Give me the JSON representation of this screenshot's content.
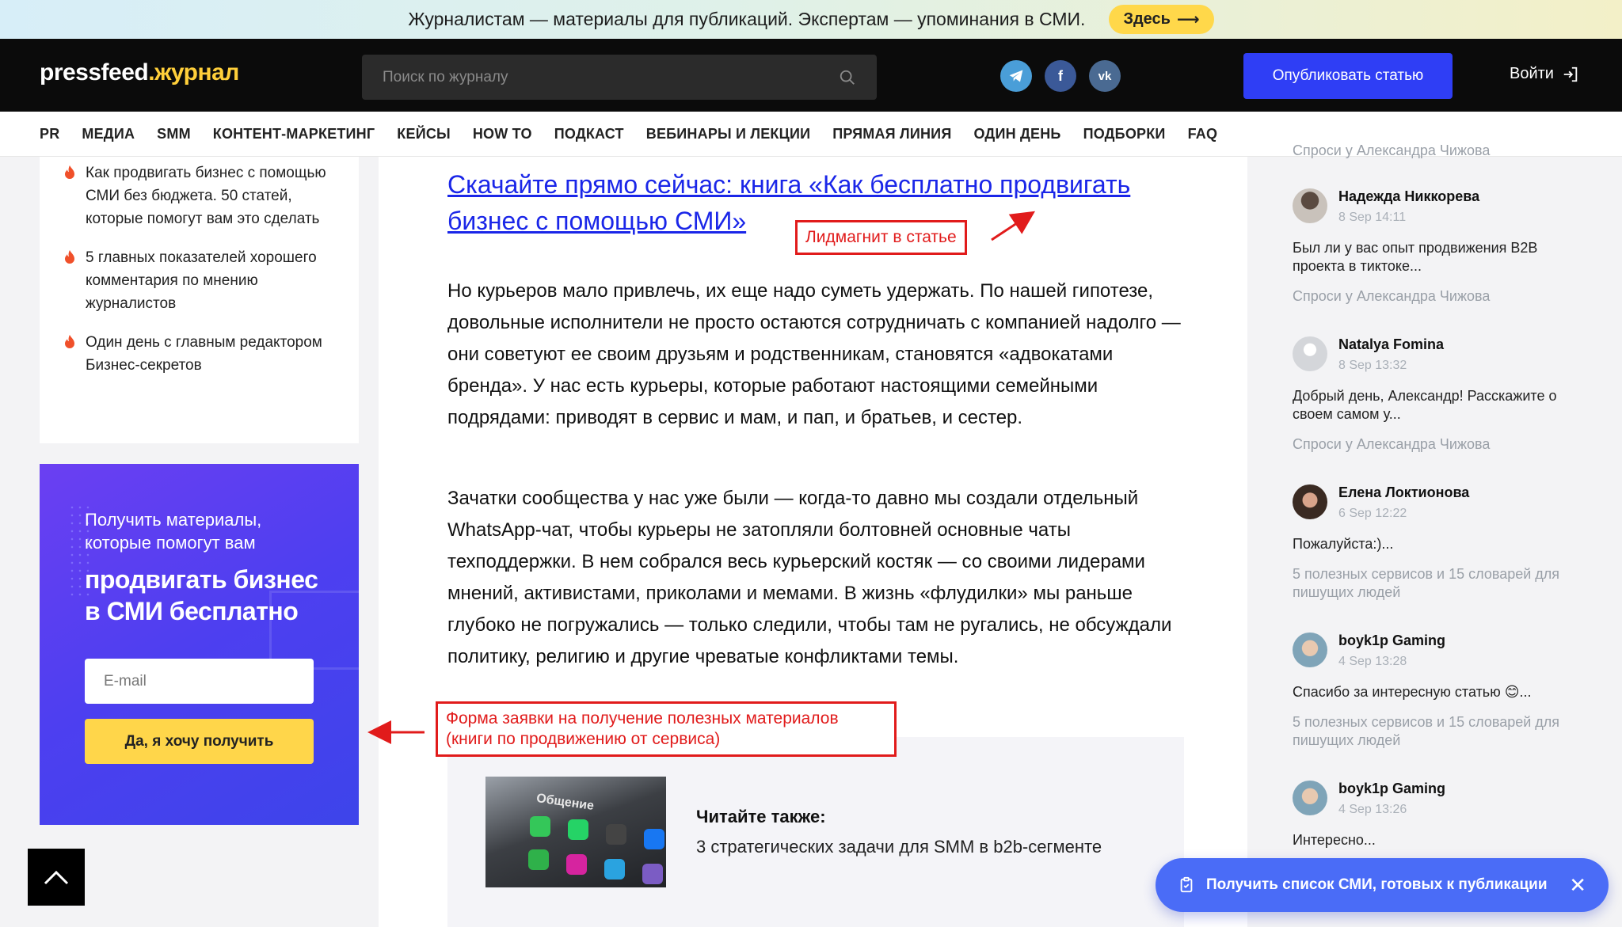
{
  "promo": {
    "text": "Журналистам — материалы для публикаций. Экспертам — упоминания в СМИ.",
    "button": "Здесь"
  },
  "header": {
    "logo_main": "pressfeed",
    "logo_accent": ".журнал",
    "search_placeholder": "Поиск по журналу",
    "publish_button": "Опубликовать статью",
    "login": "Войти"
  },
  "nav": [
    "PR",
    "МЕДИА",
    "SMM",
    "КОНТЕНТ-МАРКЕТИНГ",
    "КЕЙСЫ",
    "HOW TO",
    "ПОДКАСТ",
    "ВЕБИНАРЫ И ЛЕКЦИИ",
    "ПРЯМАЯ ЛИНИЯ",
    "ОДИН ДЕНЬ",
    "ПОДБОРКИ",
    "FAQ"
  ],
  "left": {
    "items": [
      "Как продвигать бизнес с помощью СМИ без бюджета. 50 статей, которые помогут вам это сделать",
      "5 главных показателей хорошего комментария по мнению журналистов",
      "Один день с главным редактором Бизнес-секретов"
    ],
    "lead": {
      "subtitle": "Получить материалы, которые помогут вам",
      "title": "продвигать бизнес в СМИ бесплатно",
      "email_placeholder": "E-mail",
      "button": "Да, я хочу получить"
    }
  },
  "article": {
    "lead_link": "Скачайте прямо сейчас: книга «Как бесплатно продвигать бизнес с помощью СМИ»",
    "paragraph1": "Но курьеров мало привлечь, их еще надо суметь удержать. По нашей гипотезе, довольные исполнители не просто остаются сотрудничать с компанией надолго — они советуют ее своим друзьям и родственникам, становятся «адвокатами бренда». У нас есть курьеры, которые работают настоящими семейными подрядами: приводят в сервис и  мам, и пап, и братьев, и сестер.",
    "paragraph2": "Зачатки сообщества у нас уже были — когда-то давно мы создали отдельный WhatsApp-чат, чтобы курьеры не затопляли болтовней основные чаты техподдержки. В нем собрался весь курьерский костяк — со своими лидерами мнений, активистами, приколами и мемами. В жизнь «флудилки» мы раньше глубоко не погружались — только следили, чтобы там не ругались, не обсуждали политику, религию и другие чреватые конфликтами темы.",
    "related_image_text": "Общение",
    "related_label": "Читайте также:",
    "related_title": "3 стратегических задачи для SMM в b2b-сегменте"
  },
  "annotations": {
    "leadmagnet": "Лидмагнит в статье",
    "form": "Форма заявки на получение полезных материалов (книги по продвижению от сервиса)"
  },
  "right": {
    "top_partial": "Спроси у Александра Чижова",
    "comments": [
      {
        "name": "Надежда Никкорева",
        "date": "8 Sep 14:11",
        "text": "Был ли у вас опыт продвижения B2B проекта в тиктоке...",
        "source": "Спроси у Александра Чижова"
      },
      {
        "name": "Natalya Fomina",
        "date": "8 Sep 13:32",
        "text": "Добрый день, Александр! Расскажите о своем самом у...",
        "source": "Спроси у Александра Чижова"
      },
      {
        "name": "Елена Локтионова",
        "date": "6 Sep 12:22",
        "text": "Пожалуйста:)...",
        "source": "5 полезных сервисов и 15 словарей для пишущих людей"
      },
      {
        "name": "boyk1p Gaming",
        "date": "4 Sep 13:28",
        "text": "Спасибо за интересную статью 😊...",
        "source": "5 полезных сервисов и 15 словарей для пишущих людей"
      },
      {
        "name": "boyk1p Gaming",
        "date": "4 Sep 13:26",
        "text": "Интересно...",
        "source": ""
      }
    ]
  },
  "cta": {
    "label": "Получить список СМИ, готовых к публикации"
  },
  "colors": {
    "accent_blue": "#2f3ef5",
    "logo_yellow": "#ffcf3a",
    "annotation_red": "#e11b1b",
    "link_blue": "#1a26e8"
  }
}
